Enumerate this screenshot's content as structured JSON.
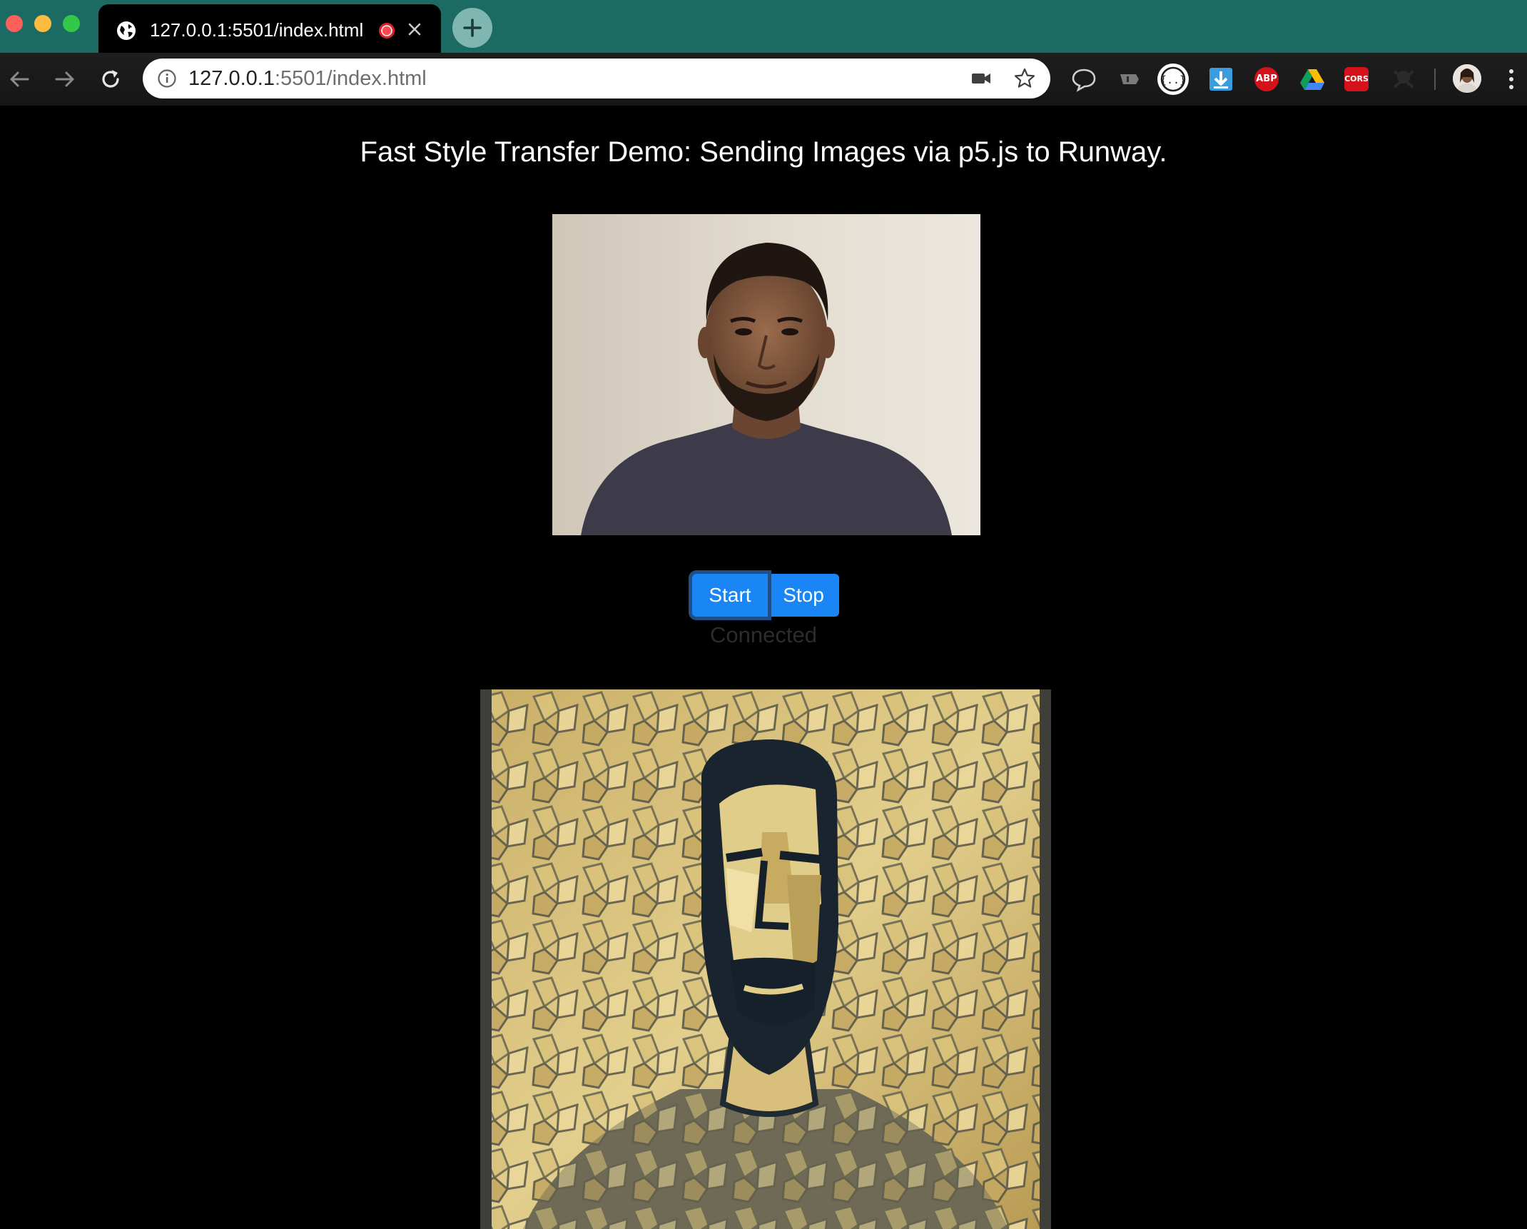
{
  "browser": {
    "tab": {
      "title": "127.0.0.1:5501/index.html"
    },
    "address_bar": {
      "url_host": "127.0.0.1",
      "url_rest": ":5501/index.html"
    },
    "extensions": {
      "abp_label": "ABP",
      "cors_label": "CORS"
    }
  },
  "page": {
    "title": "Fast Style Transfer Demo: Sending Images via p5.js to Runway.",
    "controls": {
      "start_label": "Start",
      "stop_label": "Stop"
    },
    "status": "Connected"
  },
  "colors": {
    "tab_strip": "#1b6b64",
    "page_background": "#000000",
    "button_primary": "#1a85f5",
    "button_focus_ring": "#1f4f86",
    "status_text": "#2a2d30"
  }
}
